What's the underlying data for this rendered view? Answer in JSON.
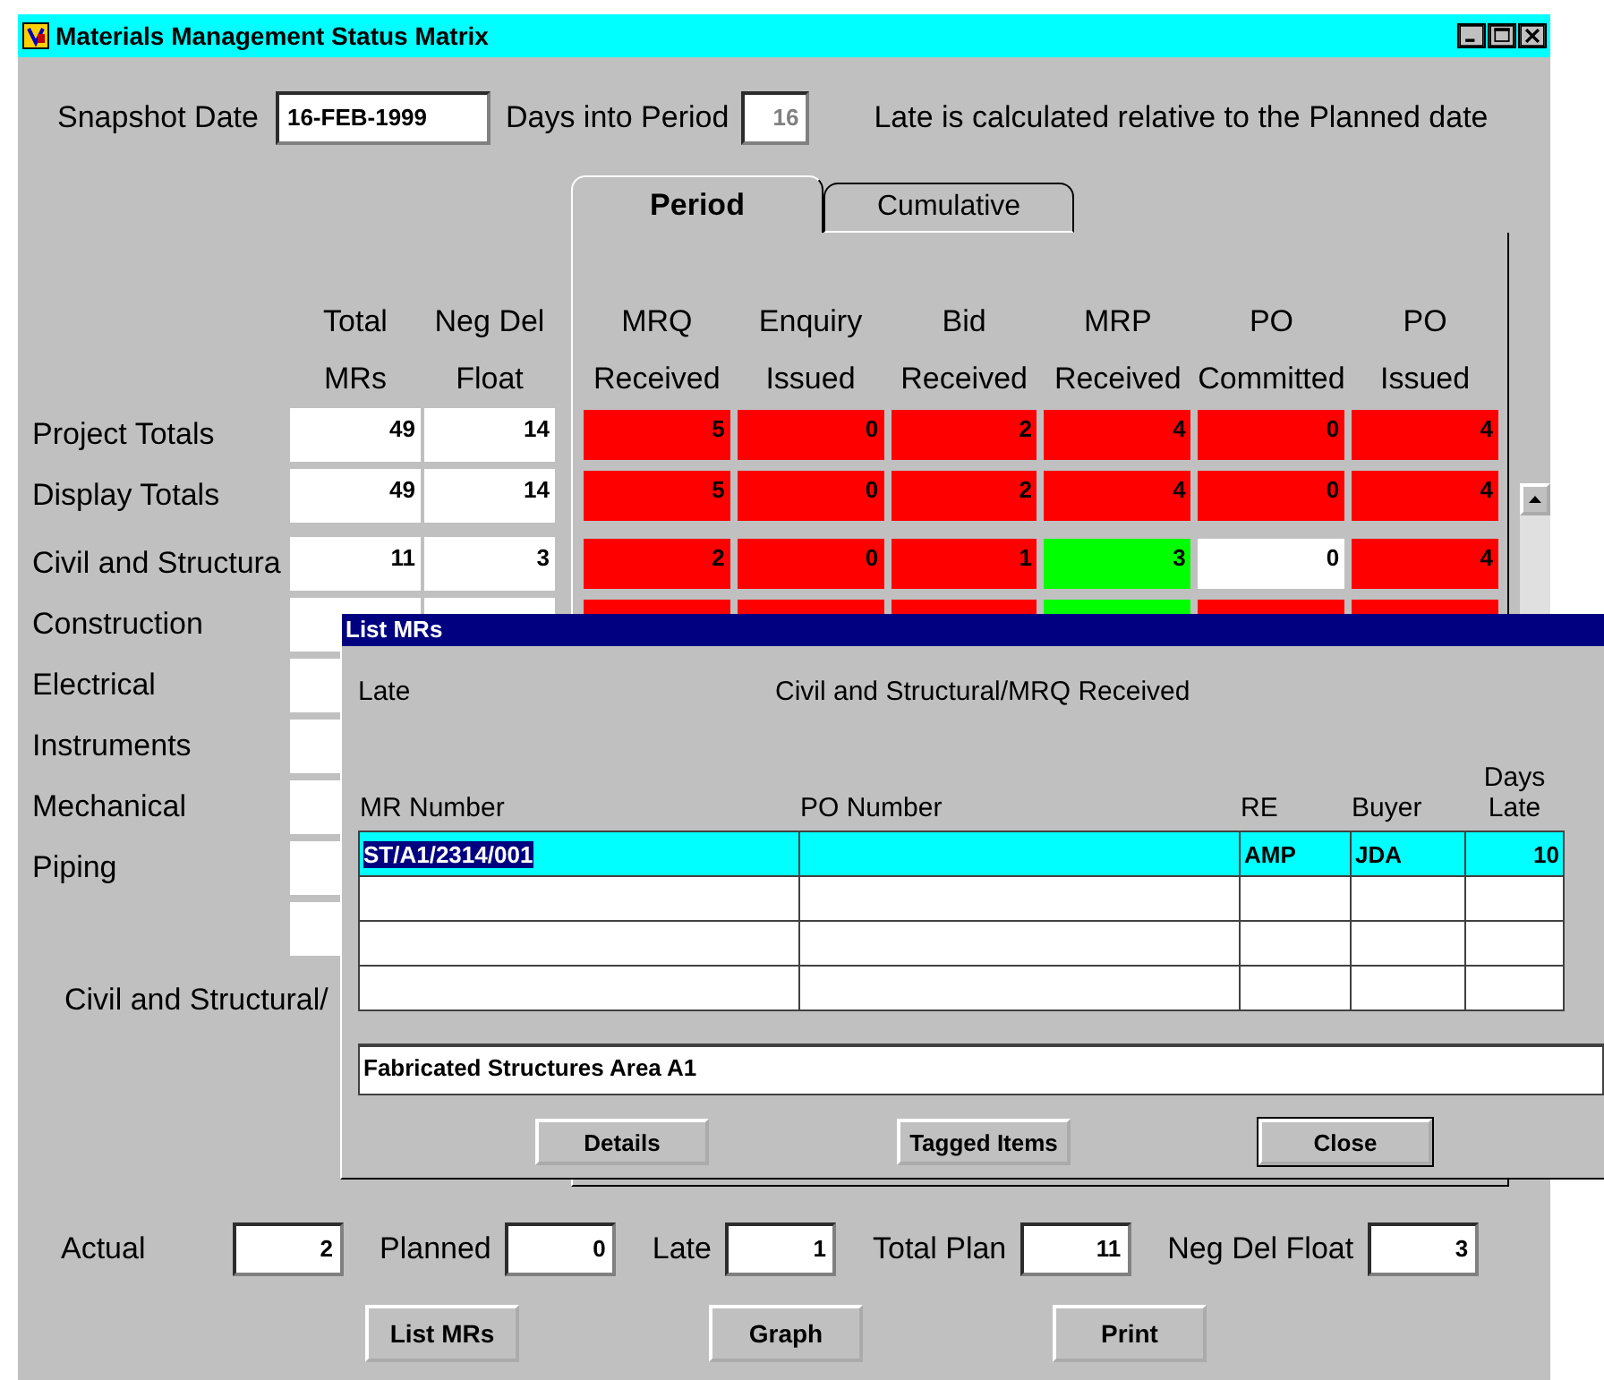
{
  "window": {
    "title": "Materials Management Status Matrix"
  },
  "snapshot": {
    "label": "Snapshot Date",
    "value": "16-FEB-1999"
  },
  "days_into_period": {
    "label": "Days into Period",
    "value": "16",
    "disabled": true
  },
  "note": "Late is calculated relative to the Planned date",
  "tabs": [
    {
      "label": "Period",
      "selected": true
    },
    {
      "label": "Cumulative",
      "selected": false
    }
  ],
  "total_columns": [
    [
      "Total",
      "MRs"
    ],
    [
      "Neg Del",
      "Float"
    ]
  ],
  "matrix_columns": [
    [
      "MRQ",
      "Received"
    ],
    [
      "Enquiry",
      "Issued"
    ],
    [
      "Bid",
      "Received"
    ],
    [
      "MRP",
      "Received"
    ],
    [
      "PO",
      "Committed"
    ],
    [
      "PO",
      "Issued"
    ]
  ],
  "rows": [
    {
      "label": "Project Totals",
      "totals": [
        "49",
        "14"
      ],
      "cells": [
        {
          "value": "5",
          "color": "#ff0000"
        },
        {
          "value": "0",
          "color": "#ff0000"
        },
        {
          "value": "2",
          "color": "#ff0000"
        },
        {
          "value": "4",
          "color": "#ff0000"
        },
        {
          "value": "0",
          "color": "#ff0000"
        },
        {
          "value": "4",
          "color": "#ff0000"
        }
      ]
    },
    {
      "label": "Display Totals",
      "totals": [
        "49",
        "14"
      ],
      "cells": [
        {
          "value": "5",
          "color": "#ff0000"
        },
        {
          "value": "0",
          "color": "#ff0000"
        },
        {
          "value": "2",
          "color": "#ff0000"
        },
        {
          "value": "4",
          "color": "#ff0000"
        },
        {
          "value": "0",
          "color": "#ff0000"
        },
        {
          "value": "4",
          "color": "#ff0000"
        }
      ]
    },
    {
      "label": "Civil and Structura",
      "totals": [
        "11",
        "3"
      ],
      "cells": [
        {
          "value": "2",
          "color": "#ff0000"
        },
        {
          "value": "0",
          "color": "#ff0000"
        },
        {
          "value": "1",
          "color": "#ff0000"
        },
        {
          "value": "3",
          "color": "#00ff00"
        },
        {
          "value": "0",
          "color": "#ffffff"
        },
        {
          "value": "4",
          "color": "#ff0000"
        }
      ]
    },
    {
      "label": "Construction",
      "cells": [
        {
          "color": "#ff0000"
        },
        {
          "color": "#ff0000"
        },
        {
          "color": "#ff0000"
        },
        {
          "color": "#00ff00"
        },
        {
          "color": "#ff0000"
        },
        {
          "color": "#ff0000"
        }
      ]
    },
    {
      "label": "Electrical"
    },
    {
      "label": "Instruments"
    },
    {
      "label": "Mechanical"
    },
    {
      "label": "Piping"
    }
  ],
  "selection_label": "Civil and Structural/",
  "summary": [
    {
      "label": "Actual",
      "value": "2"
    },
    {
      "label": "Planned",
      "value": "0"
    },
    {
      "label": "Late",
      "value": "1"
    },
    {
      "label": "Total Plan",
      "value": "11"
    },
    {
      "label": "Neg Del Float",
      "value": "3"
    }
  ],
  "buttons": [
    "List MRs",
    "Graph",
    "Print"
  ],
  "dialog": {
    "title": "List MRs",
    "mode": "Late",
    "context": "Civil and Structural/MRQ Received",
    "columns": [
      "MR Number",
      "PO Number",
      "RE",
      "Buyer",
      "Days Late"
    ],
    "rows": [
      {
        "mr_number": "ST/A1/2314/001",
        "re": "AMP",
        "buyer": "JDA",
        "days_late": "10",
        "selected": true
      }
    ],
    "description": "Fabricated Structures Area A1",
    "buttons": [
      {
        "label": "Details",
        "default": false
      },
      {
        "label": "Tagged Items",
        "default": false
      },
      {
        "label": "Close",
        "default": true
      }
    ]
  }
}
